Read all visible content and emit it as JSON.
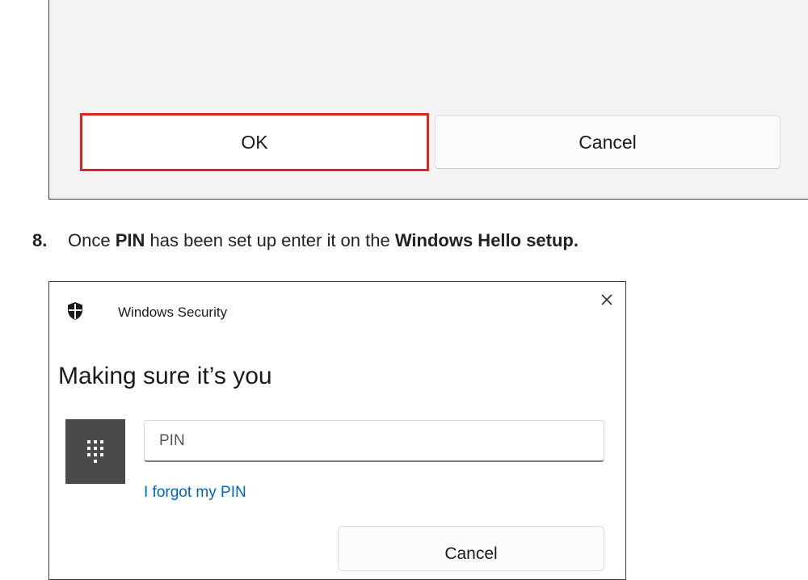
{
  "top_dialog": {
    "ok_label": "OK",
    "cancel_label": "Cancel",
    "highlight_color": "#e02424"
  },
  "step": {
    "number": "8.",
    "text_before": "Once ",
    "bold_1": "PIN",
    "text_middle": " has been set up enter it on the ",
    "bold_2": "Windows Hello setup."
  },
  "windows_security": {
    "window_title": "Windows Security",
    "heading": "Making sure it’s you",
    "pin_placeholder": "PIN",
    "forgot_link": "I forgot my PIN",
    "cancel_label": "Cancel",
    "link_color": "#0067c0",
    "icons": {
      "app": "shield-icon",
      "close": "close-icon",
      "pin": "keypad-icon"
    }
  }
}
